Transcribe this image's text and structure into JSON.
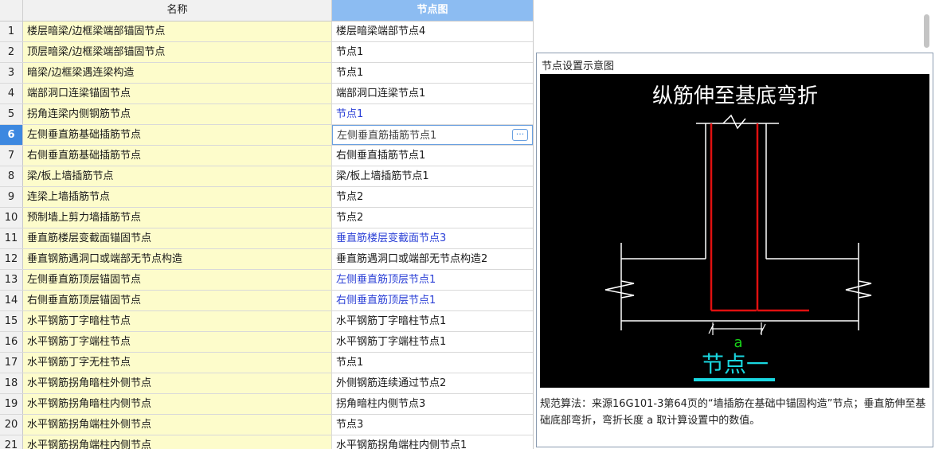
{
  "table": {
    "header": {
      "number": "",
      "name": "名称",
      "node": "节点图"
    },
    "rows": [
      {
        "n": "1",
        "name": "楼层暗梁/边框梁端部锚固节点",
        "node": "楼层暗梁端部节点4",
        "blue": false
      },
      {
        "n": "2",
        "name": "顶层暗梁/边框梁端部锚固节点",
        "node": "节点1",
        "blue": false
      },
      {
        "n": "3",
        "name": "暗梁/边框梁遇连梁构造",
        "node": "节点1",
        "blue": false
      },
      {
        "n": "4",
        "name": "端部洞口连梁锚固节点",
        "node": "端部洞口连梁节点1",
        "blue": false
      },
      {
        "n": "5",
        "name": "拐角连梁内侧钢筋节点",
        "node": "节点1",
        "blue": true
      },
      {
        "n": "6",
        "name": "左侧垂直筋基础插筋节点",
        "node": "左侧垂直筋插筋节点1",
        "blue": false,
        "selected": true
      },
      {
        "n": "7",
        "name": "右侧垂直筋基础插筋节点",
        "node": "右侧垂直插筋节点1",
        "blue": false
      },
      {
        "n": "8",
        "name": "梁/板上墙插筋节点",
        "node": "梁/板上墙插筋节点1",
        "blue": false
      },
      {
        "n": "9",
        "name": "连梁上墙插筋节点",
        "node": "节点2",
        "blue": false
      },
      {
        "n": "10",
        "name": "预制墙上剪力墙插筋节点",
        "node": "节点2",
        "blue": false
      },
      {
        "n": "11",
        "name": "垂直筋楼层变截面锚固节点",
        "node": "垂直筋楼层变截面节点3",
        "blue": true
      },
      {
        "n": "12",
        "name": "垂直钢筋遇洞口或端部无节点构造",
        "node": "垂直筋遇洞口或端部无节点构造2",
        "blue": false
      },
      {
        "n": "13",
        "name": "左侧垂直筋顶层锚固节点",
        "node": "左侧垂直筋顶层节点1",
        "blue": true
      },
      {
        "n": "14",
        "name": "右侧垂直筋顶层锚固节点",
        "node": "右侧垂直筋顶层节点1",
        "blue": true
      },
      {
        "n": "15",
        "name": "水平钢筋丁字暗柱节点",
        "node": "水平钢筋丁字暗柱节点1",
        "blue": false
      },
      {
        "n": "16",
        "name": "水平钢筋丁字端柱节点",
        "node": "水平钢筋丁字端柱节点1",
        "blue": false
      },
      {
        "n": "17",
        "name": "水平钢筋丁字无柱节点",
        "node": "节点1",
        "blue": false
      },
      {
        "n": "18",
        "name": "水平钢筋拐角暗柱外侧节点",
        "node": "外侧钢筋连续通过节点2",
        "blue": false
      },
      {
        "n": "19",
        "name": "水平钢筋拐角暗柱内侧节点",
        "node": "拐角暗柱内侧节点3",
        "blue": false
      },
      {
        "n": "20",
        "name": "水平钢筋拐角端柱外侧节点",
        "node": "节点3",
        "blue": false
      },
      {
        "n": "21",
        "name": "水平钢筋拐角端柱内侧节点",
        "node": "水平钢筋拐角端柱内侧节点1",
        "blue": false
      }
    ],
    "ellipsis": "···"
  },
  "panel": {
    "title": "节点设置示意图",
    "diagram": {
      "heading": "纵筋伸至基底弯折",
      "dimension_label": "a",
      "caption": "节点一",
      "colors": {
        "background": "#000000",
        "lines": "#ffffff",
        "rebar": "#e01010",
        "dimension": "#19d419",
        "caption": "#19d7e0"
      }
    },
    "description": "规范算法：来源16G101-3第64页的“墙插筋在基础中锚固构造”节点；垂直筋伸至基础底部弯折，弯折长度 a 取计算设置中的数值。"
  }
}
